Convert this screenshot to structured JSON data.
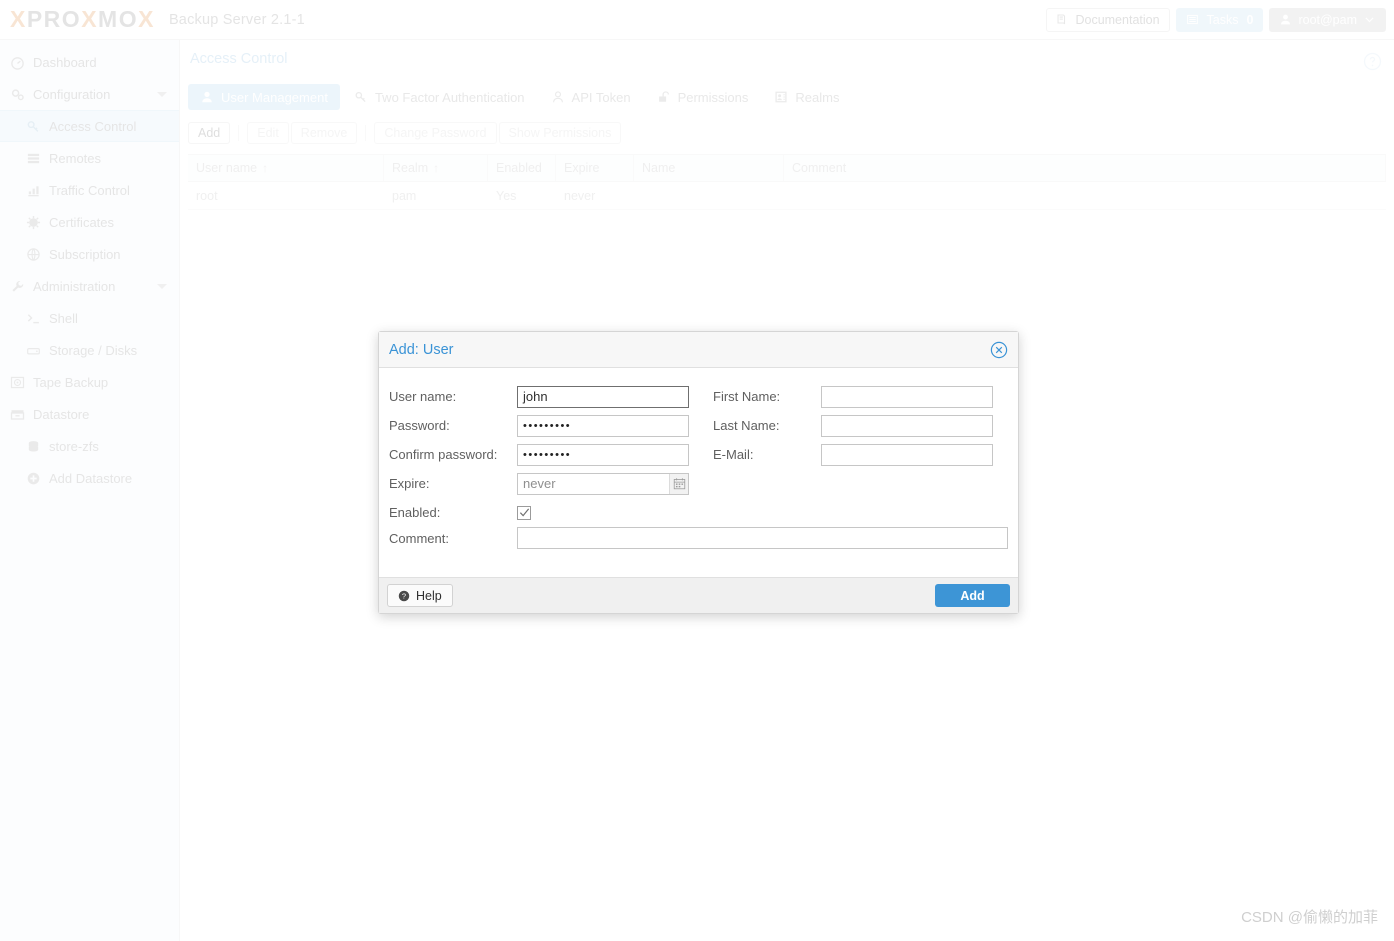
{
  "header": {
    "logo": {
      "x1": "X",
      "pro": "PRO",
      "x2": "X",
      "mo": "MO",
      "x3": "X"
    },
    "product": "Backup Server 2.1-1",
    "documentation": "Documentation",
    "tasks_label": "Tasks",
    "tasks_count": "0",
    "user": "root@pam"
  },
  "sidebar": {
    "items": [
      {
        "label": "Dashboard",
        "icon": "dashboard-icon",
        "child": false,
        "caret": false,
        "selected": false
      },
      {
        "label": "Configuration",
        "icon": "gears-icon",
        "child": false,
        "caret": true,
        "selected": false
      },
      {
        "label": "Access Control",
        "icon": "key-icon",
        "child": true,
        "caret": false,
        "selected": true
      },
      {
        "label": "Remotes",
        "icon": "server-icon",
        "child": true,
        "caret": false,
        "selected": false
      },
      {
        "label": "Traffic Control",
        "icon": "traffic-icon",
        "child": true,
        "caret": false,
        "selected": false
      },
      {
        "label": "Certificates",
        "icon": "certificate-icon",
        "child": true,
        "caret": false,
        "selected": false
      },
      {
        "label": "Subscription",
        "icon": "globe-icon",
        "child": true,
        "caret": false,
        "selected": false
      },
      {
        "label": "Administration",
        "icon": "wrench-icon",
        "child": false,
        "caret": true,
        "selected": false
      },
      {
        "label": "Shell",
        "icon": "terminal-icon",
        "child": true,
        "caret": false,
        "selected": false
      },
      {
        "label": "Storage / Disks",
        "icon": "disk-icon",
        "child": true,
        "caret": false,
        "selected": false
      },
      {
        "label": "Tape Backup",
        "icon": "tape-icon",
        "child": false,
        "caret": false,
        "selected": false
      },
      {
        "label": "Datastore",
        "icon": "datastore-icon",
        "child": false,
        "caret": false,
        "selected": false
      },
      {
        "label": "store-zfs",
        "icon": "database-icon",
        "child": true,
        "caret": false,
        "selected": false
      },
      {
        "label": "Add Datastore",
        "icon": "plus-circle-icon",
        "child": true,
        "caret": false,
        "selected": false
      }
    ]
  },
  "main": {
    "page_title": "Access Control",
    "tabs": [
      {
        "label": "User Management",
        "icon": "user-icon",
        "active": true
      },
      {
        "label": "Two Factor Authentication",
        "icon": "key-icon",
        "active": false
      },
      {
        "label": "API Token",
        "icon": "user-outline-icon",
        "active": false
      },
      {
        "label": "Permissions",
        "icon": "unlock-icon",
        "active": false
      },
      {
        "label": "Realms",
        "icon": "id-card-icon",
        "active": false
      }
    ],
    "toolbar": [
      {
        "label": "Add",
        "enabled": true
      },
      {
        "label": "Edit",
        "enabled": false
      },
      {
        "label": "Remove",
        "enabled": false
      },
      {
        "label": "Change Password",
        "enabled": false
      },
      {
        "label": "Show Permissions",
        "enabled": false
      }
    ],
    "grid": {
      "columns": [
        {
          "label": "User name",
          "sort": "↑"
        },
        {
          "label": "Realm",
          "sort": "↑"
        },
        {
          "label": "Enabled",
          "sort": ""
        },
        {
          "label": "Expire",
          "sort": ""
        },
        {
          "label": "Name",
          "sort": ""
        },
        {
          "label": "Comment",
          "sort": ""
        }
      ],
      "rows": [
        {
          "username": "root",
          "realm": "pam",
          "enabled": "Yes",
          "expire": "never",
          "name": "",
          "comment": ""
        }
      ]
    }
  },
  "dialog": {
    "title": "Add: User",
    "fields": {
      "username_label": "User name:",
      "username_value": "john",
      "password_label": "Password:",
      "password_value": "•••••••••",
      "confirm_label": "Confirm password:",
      "confirm_value": "•••••••••",
      "expire_label": "Expire:",
      "expire_value": "never",
      "enabled_label": "Enabled:",
      "firstname_label": "First Name:",
      "firstname_value": "",
      "lastname_label": "Last Name:",
      "lastname_value": "",
      "email_label": "E-Mail:",
      "email_value": "",
      "comment_label": "Comment:",
      "comment_value": ""
    },
    "help_label": "Help",
    "submit_label": "Add"
  },
  "watermark": "CSDN @偷懒的加菲",
  "colors": {
    "accent_blue": "#3d95d6",
    "tab_active": "#a9d4f0",
    "logo_orange": "#e88b3c",
    "selected_nav": "#d9ecfa"
  }
}
